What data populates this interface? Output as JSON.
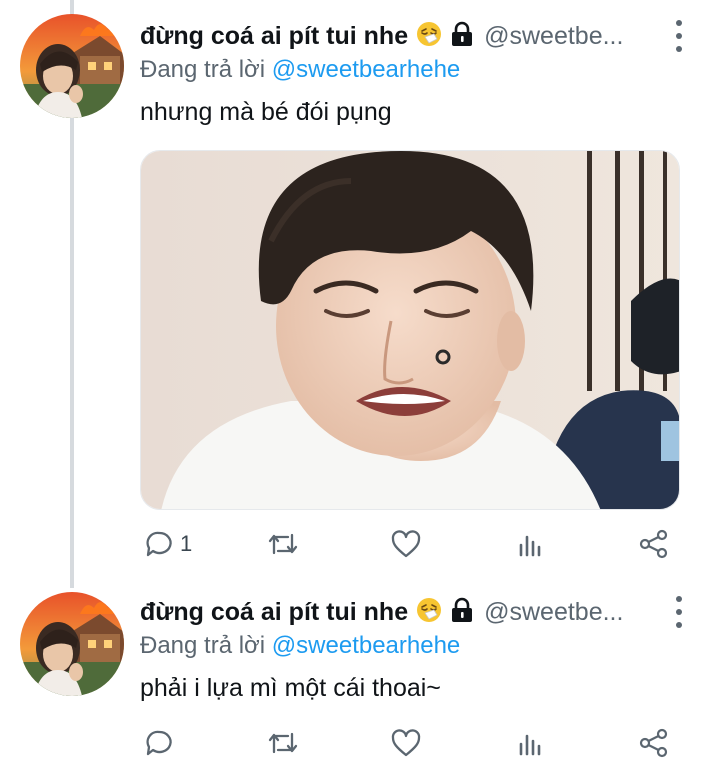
{
  "tweets": [
    {
      "display_name": "đừng coá ai pít tui nhe",
      "handle": "@sweetbe...",
      "reply_prefix": "Đang trả lời",
      "reply_mention": "@sweetbearhehe",
      "text": "nhưng mà bé đói pụng",
      "has_media": true,
      "reply_count": "1"
    },
    {
      "display_name": "đừng coá ai pít tui nhe",
      "handle": "@sweetbe...",
      "reply_prefix": "Đang trả lời",
      "reply_mention": "@sweetbearhehe",
      "text": "phải i lựa mì một cái thoai~",
      "has_media": false,
      "reply_count": ""
    }
  ],
  "icons": {
    "badge_emoji": "sneezing-face-emoji",
    "lock": "lock-icon",
    "more": "more-vertical-icon",
    "reply": "reply-icon",
    "retweet": "retweet-icon",
    "like": "heart-icon",
    "views": "views-icon",
    "share": "share-icon"
  },
  "colors": {
    "link": "#1d9bf0",
    "secondary_text": "#5b6670",
    "thread_line": "#d6dade"
  }
}
